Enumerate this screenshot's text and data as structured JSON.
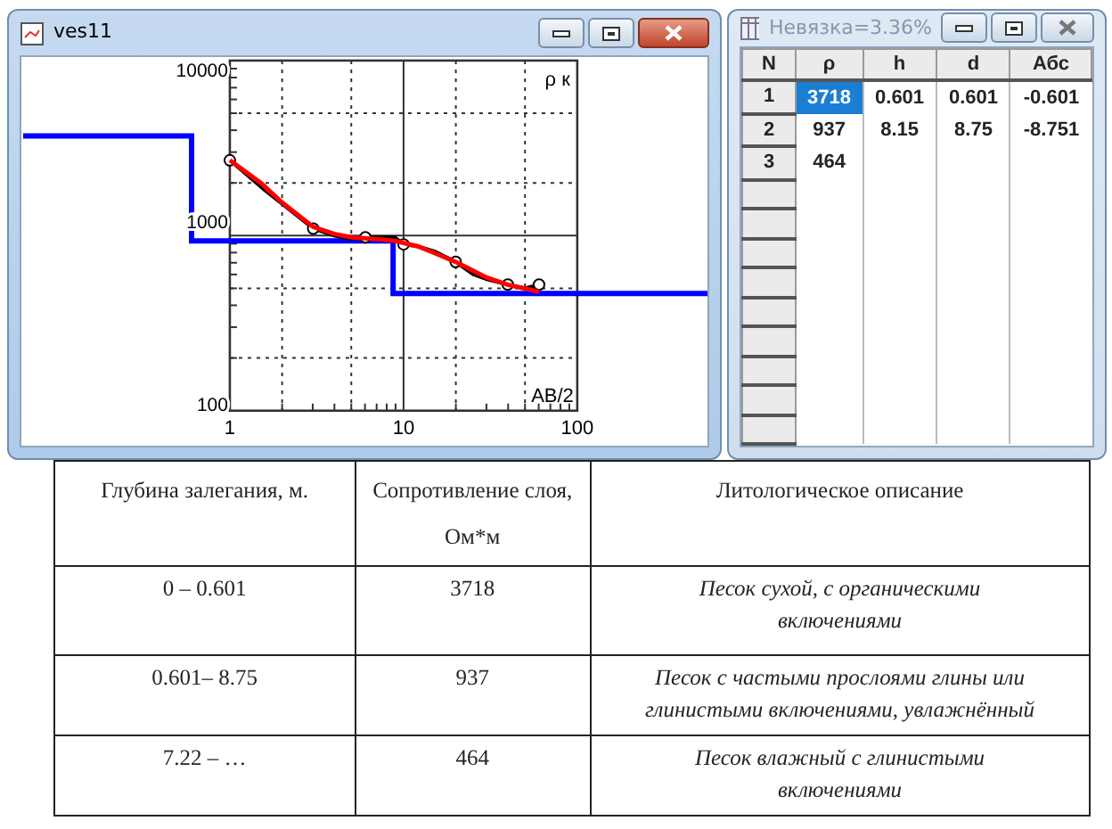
{
  "chart_window": {
    "title": "ves11",
    "active": true,
    "plot": {
      "x_axis_label": "AB/2",
      "y_axis_label": "ρ к",
      "x_tick_labels": [
        "1",
        "10",
        "100"
      ],
      "y_tick_labels": [
        "10000",
        "1000",
        "100"
      ]
    }
  },
  "table_window": {
    "title": "Невязка=3.36%",
    "active": false,
    "columns": [
      "N",
      "ρ",
      "h",
      "d",
      "Абс"
    ],
    "rows": [
      {
        "cells": [
          {
            "text": "1",
            "selected": false
          },
          {
            "text": "3718",
            "selected": true
          },
          {
            "text": "0.601",
            "selected": false
          },
          {
            "text": "0.601",
            "selected": false
          },
          {
            "text": "-0.601",
            "selected": false
          }
        ]
      },
      {
        "cells": [
          {
            "text": "2",
            "selected": false
          },
          {
            "text": "937",
            "selected": false
          },
          {
            "text": "8.15",
            "selected": false
          },
          {
            "text": "8.75",
            "selected": false
          },
          {
            "text": "-8.751",
            "selected": false
          }
        ]
      },
      {
        "cells": [
          {
            "text": "3",
            "selected": false
          },
          {
            "text": "464",
            "selected": false
          }
        ]
      }
    ]
  },
  "layers_table": {
    "columns": [
      "Глубина залегания, м.",
      "Сопротивление слоя, Ом*м",
      "Литологическое описание"
    ],
    "rows": [
      {
        "depth": "0 – 0.601",
        "resistance": "3718",
        "description": "Песок сухой, с органическими включениями"
      },
      {
        "depth": "0.601– 8.75",
        "resistance": "937",
        "description": "Песок с частыми прослоями глины или глинистыми включениями, увлажнённый"
      },
      {
        "depth": "7.22 – …",
        "resistance": "464",
        "description": "Песок влажный с глинистыми включениями"
      }
    ]
  }
}
